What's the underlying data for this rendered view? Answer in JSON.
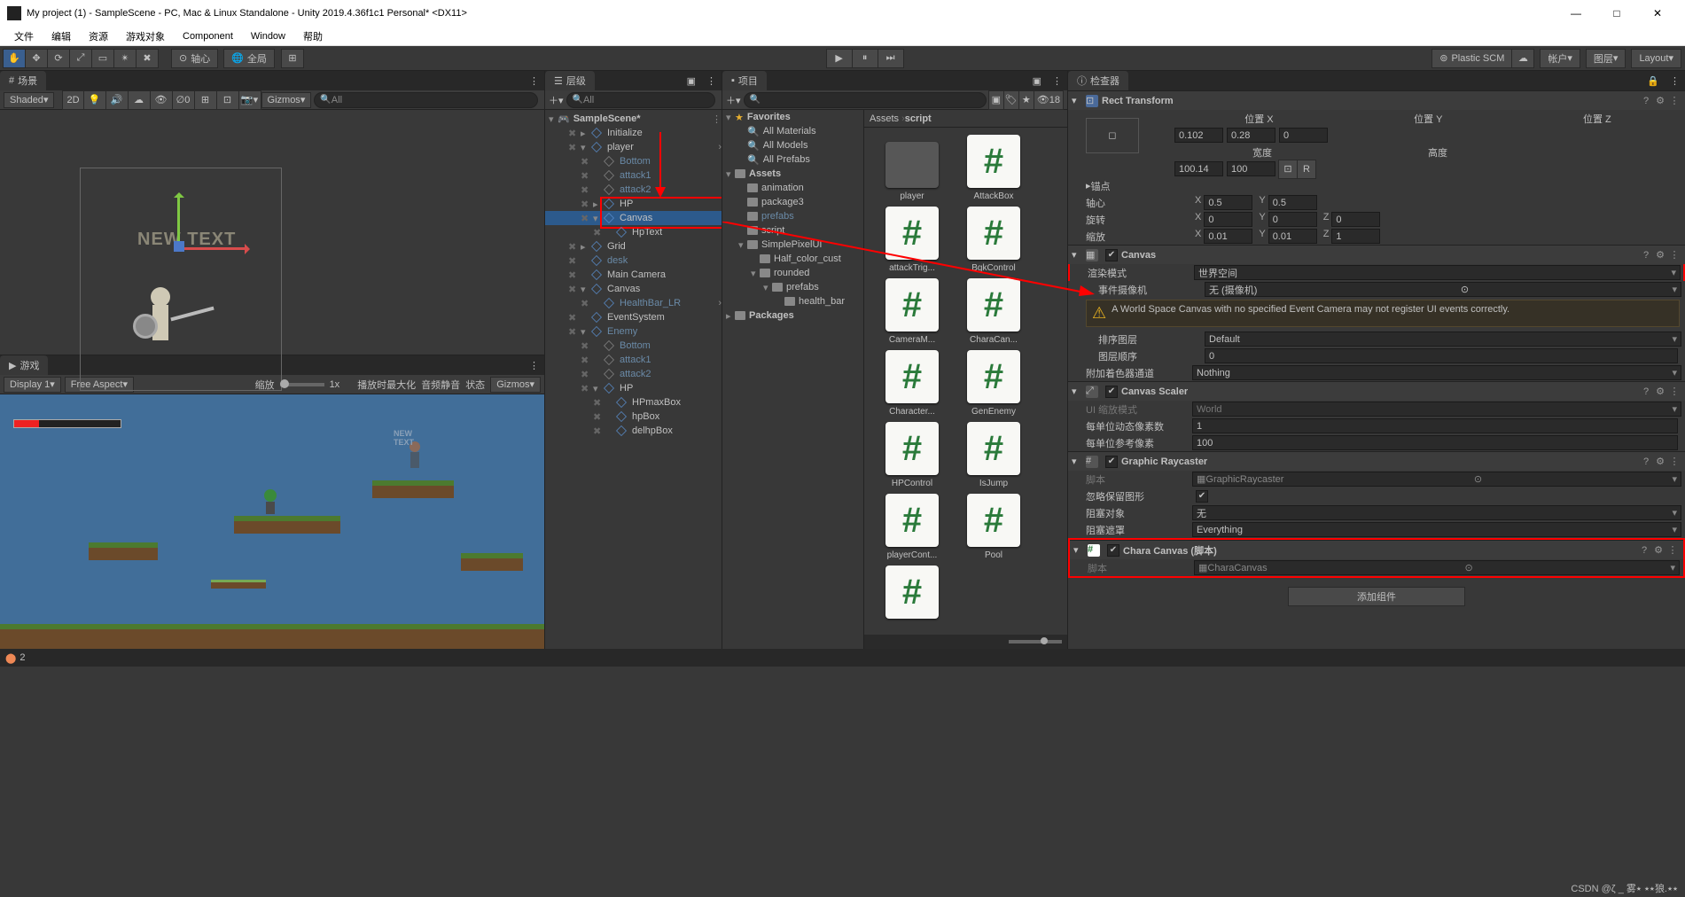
{
  "window": {
    "title": "My project (1) - SampleScene - PC, Mac & Linux Standalone - Unity 2019.4.36f1c1 Personal* <DX11>"
  },
  "menu": [
    "文件",
    "编辑",
    "资源",
    "游戏对象",
    "Component",
    "Window",
    "帮助"
  ],
  "toolbar": {
    "pivot": "轴心",
    "global": "全局",
    "plastic": "Plastic SCM",
    "account": "帐户",
    "layers": "图层",
    "layout": "Layout"
  },
  "scene_tab": {
    "label": "场景",
    "shading": "Shaded",
    "mode2d": "2D",
    "gizmos": "Gizmos",
    "search_placeholder": "All",
    "new_text": "NEW TEXT"
  },
  "game_tab": {
    "label": "游戏",
    "display": "Display 1",
    "aspect": "Free Aspect",
    "scale_label": "缩放",
    "scale_value": "1x",
    "maximize": "播放时最大化",
    "mute": "音频静音",
    "status": "状态",
    "gizmos": "Gizmos",
    "new_text": "NEW TEXT"
  },
  "hierarchy": {
    "tab": "层级",
    "search_placeholder": "All",
    "scene": "SampleScene*",
    "items": [
      {
        "indent": 1,
        "name": "Initialize",
        "arrow": "▸"
      },
      {
        "indent": 1,
        "name": "player",
        "arrow": "▾",
        "faded": false,
        "chev": "›"
      },
      {
        "indent": 2,
        "name": "Bottom",
        "faded": true
      },
      {
        "indent": 2,
        "name": "attack1",
        "faded": true
      },
      {
        "indent": 2,
        "name": "attack2",
        "faded": true
      },
      {
        "indent": 2,
        "name": "HP",
        "arrow": "▸"
      },
      {
        "indent": 2,
        "name": "Canvas",
        "arrow": "▾",
        "sel": true,
        "redbox": true
      },
      {
        "indent": 3,
        "name": "HpText",
        "redbox": true
      },
      {
        "indent": 1,
        "name": "Grid",
        "arrow": "▸"
      },
      {
        "indent": 1,
        "name": "desk",
        "faded": false,
        "color": "#6a8aa7"
      },
      {
        "indent": 1,
        "name": "Main Camera"
      },
      {
        "indent": 1,
        "name": "Canvas",
        "arrow": "▾"
      },
      {
        "indent": 2,
        "name": "HealthBar_LR",
        "color": "#6a8aa7",
        "chev": "›"
      },
      {
        "indent": 1,
        "name": "EventSystem"
      },
      {
        "indent": 1,
        "name": "Enemy",
        "arrow": "▾",
        "color": "#6a8aa7"
      },
      {
        "indent": 2,
        "name": "Bottom",
        "faded": true
      },
      {
        "indent": 2,
        "name": "attack1",
        "faded": true
      },
      {
        "indent": 2,
        "name": "attack2",
        "faded": true
      },
      {
        "indent": 2,
        "name": "HP",
        "arrow": "▾"
      },
      {
        "indent": 3,
        "name": "HPmaxBox"
      },
      {
        "indent": 3,
        "name": "hpBox"
      },
      {
        "indent": 3,
        "name": "delhpBox"
      }
    ]
  },
  "project": {
    "tab": "项目",
    "eye": "18",
    "search_placeholder": "",
    "breadcrumb": [
      "Assets",
      "script"
    ],
    "tree": [
      {
        "indent": 0,
        "name": "Favorites",
        "star": true,
        "arrow": "▾"
      },
      {
        "indent": 1,
        "name": "All Materials",
        "lens": true
      },
      {
        "indent": 1,
        "name": "All Models",
        "lens": true
      },
      {
        "indent": 1,
        "name": "All Prefabs",
        "lens": true
      },
      {
        "indent": 0,
        "name": "Assets",
        "arrow": "▾"
      },
      {
        "indent": 1,
        "name": "animation"
      },
      {
        "indent": 1,
        "name": "package3"
      },
      {
        "indent": 1,
        "name": "prefabs",
        "color": "#6a8aa7"
      },
      {
        "indent": 1,
        "name": "script"
      },
      {
        "indent": 1,
        "name": "SimplePixelUI",
        "arrow": "▾"
      },
      {
        "indent": 2,
        "name": "Half_color_cust"
      },
      {
        "indent": 2,
        "name": "rounded",
        "arrow": "▾"
      },
      {
        "indent": 3,
        "name": "prefabs",
        "arrow": "▾"
      },
      {
        "indent": 4,
        "name": "health_bar"
      },
      {
        "indent": 0,
        "name": "Packages",
        "arrow": "▸"
      }
    ],
    "files": [
      "player",
      "AttackBox",
      "attackTrig...",
      "BgkControl",
      "CameraM...",
      "CharaCan...",
      "Character...",
      "GenEnemy",
      "HPControl",
      "IsJump",
      "playerCont...",
      "Pool",
      ""
    ]
  },
  "inspector": {
    "tab": "检查器",
    "rect": {
      "title": "Rect Transform",
      "pos_labels": [
        "位置 X",
        "位置 Y",
        "位置 Z"
      ],
      "pos": [
        "0.102",
        "0.28",
        "0"
      ],
      "size_labels": [
        "宽度",
        "高度"
      ],
      "size": [
        "100.14",
        "100"
      ],
      "anchors": "锚点",
      "pivot_label": "轴心",
      "pivot": [
        "0.5",
        "0.5"
      ],
      "rot_label": "旋转",
      "rot": [
        "0",
        "0",
        "0"
      ],
      "scale_label": "缩放",
      "scale": [
        "0.01",
        "0.01",
        "1"
      ]
    },
    "canvas": {
      "title": "Canvas",
      "render_mode_label": "渲染模式",
      "render_mode": "世界空间",
      "event_cam_label": "事件摄像机",
      "event_cam": "无 (摄像机)",
      "warning": "A World Space Canvas with no specified Event Camera may not register UI events correctly.",
      "layer_label": "排序图层",
      "layer": "Default",
      "order_label": "图层顺序",
      "order": "0",
      "shader_label": "附加着色器通道",
      "shader": "Nothing"
    },
    "scaler": {
      "title": "Canvas Scaler",
      "mode_label": "UI 缩放模式",
      "mode": "World",
      "dyn_label": "每单位动态像素数",
      "dyn": "1",
      "ref_label": "每单位参考像素",
      "ref": "100"
    },
    "raycaster": {
      "title": "Graphic Raycaster",
      "script_label": "脚本",
      "script": "GraphicRaycaster",
      "ignore_label": "忽略保留图形",
      "ignore": true,
      "block_obj_label": "阻塞对象",
      "block_obj": "无",
      "block_mask_label": "阻塞遮罩",
      "block_mask": "Everything"
    },
    "chara": {
      "title": "Chara Canvas   (脚本)",
      "script_label": "脚本",
      "script": "CharaCanvas"
    },
    "add_component": "添加组件"
  },
  "status": {
    "errors": "2"
  },
  "watermark": "CSDN @ζ _ 雾٭٭ ٭狼.٭٭"
}
